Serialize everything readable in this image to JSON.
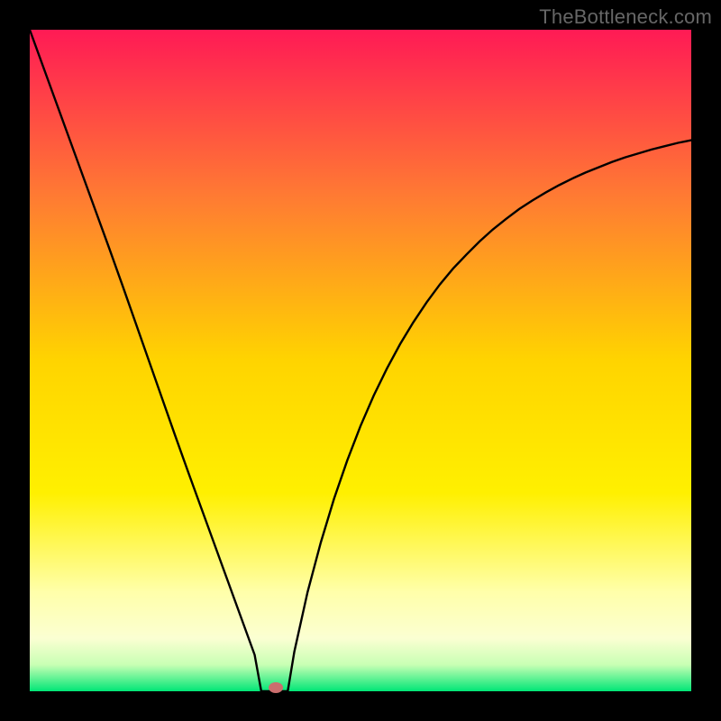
{
  "watermark": "TheBottleneck.com",
  "chart_data": {
    "type": "line",
    "x": [
      0.0,
      0.02,
      0.04,
      0.06,
      0.08,
      0.1,
      0.12,
      0.14,
      0.16,
      0.18,
      0.2,
      0.22,
      0.24,
      0.26,
      0.28,
      0.3,
      0.32,
      0.34,
      0.35,
      0.355,
      0.36,
      0.365,
      0.37,
      0.375,
      0.38,
      0.385,
      0.39,
      0.4,
      0.42,
      0.44,
      0.46,
      0.48,
      0.5,
      0.52,
      0.54,
      0.56,
      0.58,
      0.6,
      0.62,
      0.64,
      0.66,
      0.68,
      0.7,
      0.72,
      0.74,
      0.76,
      0.78,
      0.8,
      0.82,
      0.84,
      0.86,
      0.88,
      0.9,
      0.92,
      0.94,
      0.96,
      0.98,
      1.0
    ],
    "values": [
      1.0,
      0.945,
      0.89,
      0.835,
      0.78,
      0.725,
      0.67,
      0.614,
      0.557,
      0.5,
      0.443,
      0.386,
      0.33,
      0.275,
      0.22,
      0.165,
      0.11,
      0.055,
      0.0,
      0.0,
      0.0,
      0.0,
      0.0,
      0.0,
      0.0,
      0.0,
      0.0,
      0.06,
      0.15,
      0.225,
      0.291,
      0.349,
      0.401,
      0.447,
      0.488,
      0.525,
      0.558,
      0.588,
      0.615,
      0.639,
      0.66,
      0.68,
      0.698,
      0.714,
      0.729,
      0.742,
      0.754,
      0.765,
      0.775,
      0.784,
      0.792,
      0.8,
      0.807,
      0.813,
      0.819,
      0.824,
      0.829,
      0.833
    ],
    "marker": {
      "x": 0.372,
      "y": 0.0,
      "color": "#cc6e6e"
    },
    "xlim": [
      0,
      1
    ],
    "ylim": [
      0,
      1
    ],
    "title": "",
    "xlabel": "",
    "ylabel": "",
    "gradient_stops": [
      {
        "offset": 0.0,
        "color": "#ff1a55"
      },
      {
        "offset": 0.25,
        "color": "#ff7a33"
      },
      {
        "offset": 0.5,
        "color": "#ffd400"
      },
      {
        "offset": 0.7,
        "color": "#fff000"
      },
      {
        "offset": 0.85,
        "color": "#ffffaa"
      },
      {
        "offset": 0.92,
        "color": "#fbffd2"
      },
      {
        "offset": 0.96,
        "color": "#c8ffb4"
      },
      {
        "offset": 1.0,
        "color": "#00e676"
      }
    ],
    "bottom_band": {
      "from": 0.94,
      "to": 1.0
    }
  },
  "colors": {
    "frame": "#000000",
    "curve": "#000000",
    "watermark": "#666666"
  }
}
